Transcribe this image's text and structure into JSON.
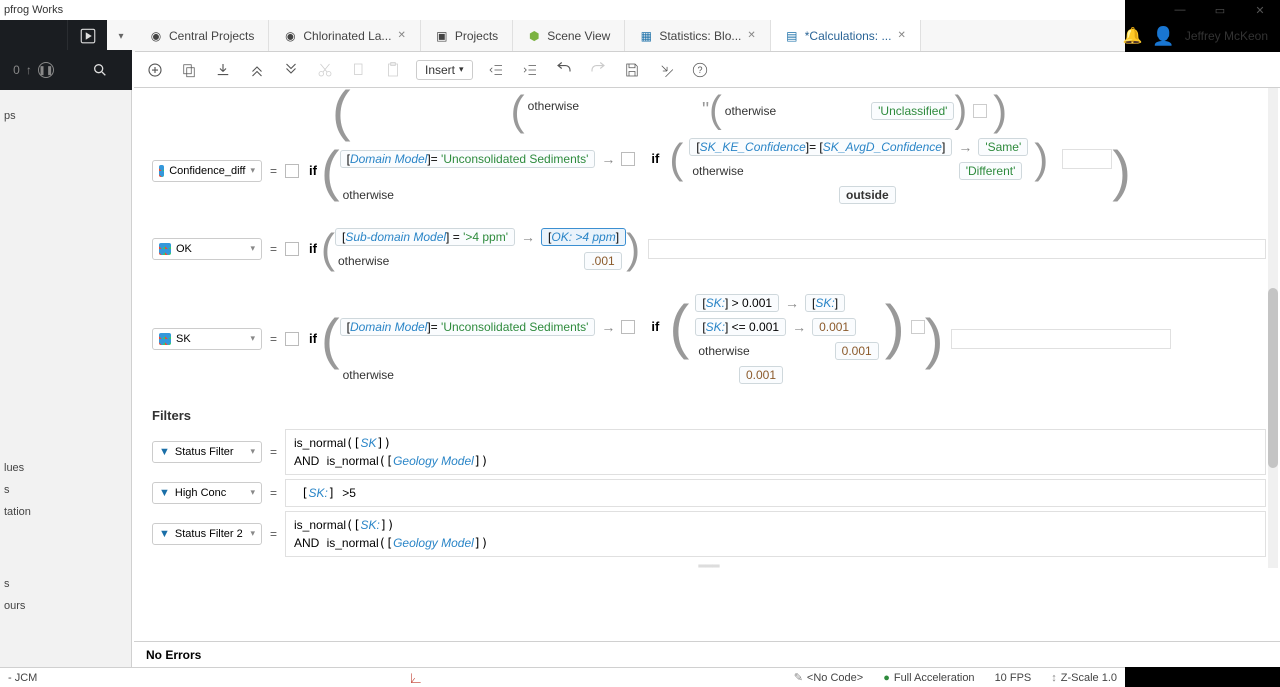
{
  "title": "pfrog Works",
  "tabs": [
    {
      "label": "Central Projects"
    },
    {
      "label": "Chlorinated La..."
    },
    {
      "label": "Projects"
    },
    {
      "label": "Scene View"
    },
    {
      "label": "Statistics: Blo..."
    },
    {
      "label": "*Calculations: ..."
    }
  ],
  "user": "Jeffrey McKeon",
  "toolbar": {
    "insert": "Insert"
  },
  "tree": {
    "items": [
      "ps",
      "lues",
      "s",
      "tation",
      "s",
      "ours"
    ]
  },
  "vars": {
    "confidence": "Confidence_diff",
    "ok": "OK",
    "sk": "SK"
  },
  "expr": {
    "otherwise": "otherwise",
    "ifkw": "if",
    "unclassified": "'Unclassified'",
    "domain_model": "Domain Model",
    "unconsolidated": "'Unconsolidated Sediments'",
    "sk_ke": "SK_KE_Confidence",
    "sk_avgd": "SK_AvgD_Confidence",
    "same": "'Same'",
    "different": "'Different'",
    "outside": "outside",
    "subdomain": "Sub-domain Model",
    "gt4ppm": "'>4 ppm'",
    "ok_gt4": "OK: >4 ppm",
    "p001": ".001",
    "sk_ref": "SK:",
    "gt001": "> 0.001",
    "le001": "<= 0.001",
    "n001": "0.001"
  },
  "filters_title": "Filters",
  "filters": {
    "status": "Status Filter",
    "high": "High Conc",
    "status2": "Status Filter 2",
    "sk": "SK",
    "sk_col": "SK:",
    "geology": "Geology Model",
    "is_normal": "is_normal",
    "and": "AND",
    "gt5": ">5"
  },
  "errors": "No Errors",
  "status": {
    "left": "- JCM",
    "nocode": "<No Code>",
    "accel": "Full Acceleration",
    "fps": "10 FPS",
    "zscale": "Z-Scale 1.0"
  },
  "pause_count": "0"
}
